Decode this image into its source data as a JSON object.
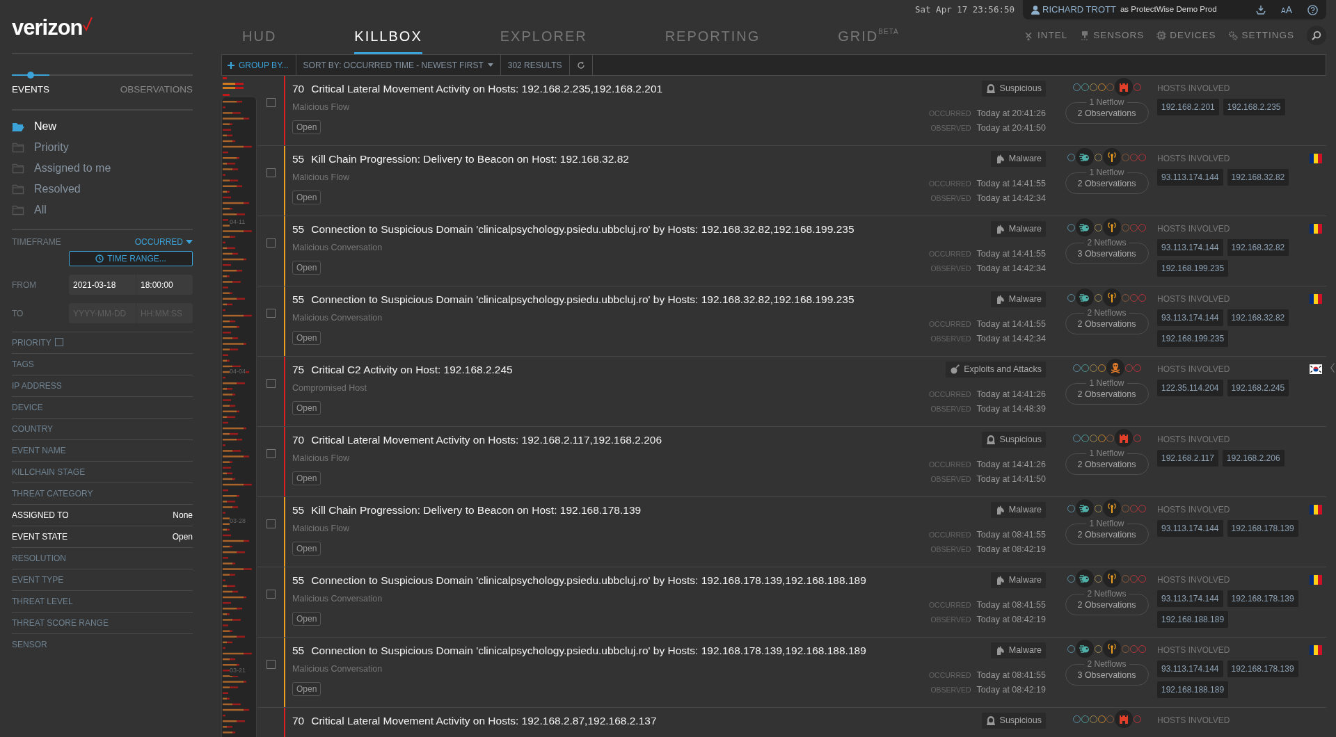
{
  "sidebar": {
    "logo": "verizon",
    "view_tabs": [
      {
        "label": "EVENTS",
        "selected": true
      },
      {
        "label": "OBSERVATIONS",
        "selected": false
      }
    ],
    "folders": [
      {
        "label": "New",
        "selected": true
      },
      {
        "label": "Priority",
        "selected": false
      },
      {
        "label": "Assigned to me",
        "selected": false
      },
      {
        "label": "Resolved",
        "selected": false
      },
      {
        "label": "All",
        "selected": false
      }
    ],
    "timeframe": {
      "label": "TIMEFRAME",
      "mode": "OCCURRED",
      "range_button": "TIME RANGE...",
      "from": {
        "label": "FROM",
        "date": "2021-03-18",
        "time": "18:00:00"
      },
      "to": {
        "label": "TO",
        "date_placeholder": "YYYY-MM-DD",
        "time_placeholder": "HH:MM:SS"
      }
    },
    "filters": [
      {
        "label": "PRIORITY",
        "kind": "checkbox",
        "checked": false
      },
      {
        "label": "TAGS",
        "kind": "plain"
      },
      {
        "label": "IP ADDRESS",
        "kind": "plain"
      },
      {
        "label": "DEVICE",
        "kind": "plain"
      },
      {
        "label": "COUNTRY",
        "kind": "plain"
      },
      {
        "label": "EVENT NAME",
        "kind": "plain"
      },
      {
        "label": "KILLCHAIN STAGE",
        "kind": "plain"
      },
      {
        "label": "THREAT CATEGORY",
        "kind": "plain"
      },
      {
        "label": "ASSIGNED TO",
        "kind": "value",
        "value": "None"
      },
      {
        "label": "EVENT STATE",
        "kind": "value",
        "value": "Open"
      },
      {
        "label": "RESOLUTION",
        "kind": "plain"
      },
      {
        "label": "EVENT TYPE",
        "kind": "plain"
      },
      {
        "label": "THREAT LEVEL",
        "kind": "plain"
      },
      {
        "label": "THREAT SCORE RANGE",
        "kind": "plain"
      },
      {
        "label": "SENSOR",
        "kind": "plain"
      }
    ]
  },
  "header": {
    "clock": "Sat Apr 17 23:56:50",
    "user": {
      "name": "RICHARD TROTT",
      "context": "as ProtectWise Demo Prod"
    },
    "font_size_letters": [
      "A",
      "A"
    ],
    "tabs": [
      {
        "label": "HUD",
        "selected": false
      },
      {
        "label": "KILLBOX",
        "selected": true
      },
      {
        "label": "EXPLORER",
        "selected": false
      },
      {
        "label": "REPORTING",
        "selected": false
      },
      {
        "label": "GRID$^{BETA}$",
        "selected": false
      }
    ],
    "tools": [
      {
        "kind": "intel",
        "label": "INTEL"
      },
      {
        "kind": "sensors",
        "label": "SENSORS"
      },
      {
        "kind": "devices",
        "label": "DEVICES"
      },
      {
        "kind": "settings",
        "label": "SETTINGS"
      }
    ]
  },
  "toolbar": {
    "group_by": "GROUP BY...",
    "sort": "SORT BY: OCCURRED TIME - NEWEST FIRST",
    "results": "302 RESULTS"
  },
  "timeline": {
    "labels": [
      "04-11",
      "04-04",
      "03-28",
      "03-21"
    ]
  },
  "events": [
    {
      "score": "70",
      "color": "#e02020",
      "checked": false,
      "title": "Critical Lateral Movement Activity on Hosts: 192.168.2.235,192.168.2.201",
      "category": "Malicious Flow",
      "status": "Open",
      "tag": {
        "kind": "suspicious",
        "label": "Suspicious"
      },
      "killchain": [
        {
          "active": false
        },
        {
          "active": false
        },
        {
          "active": false
        },
        {
          "active": false
        },
        {
          "active": false
        },
        {
          "active": true
        },
        {
          "active": false
        }
      ],
      "occurred": {
        "label": "OCCURRED",
        "value": "Today at 20:41:26"
      },
      "observed": {
        "label": "OBSERVED",
        "value": "Today at 20:41:50"
      },
      "netflows": "1 Netflow",
      "observations": "2 Observations",
      "hosts_label": "HOSTS INVOLVED",
      "hosts": [
        "192.168.2.201",
        "192.168.2.235"
      ]
    },
    {
      "score": "55",
      "color": "#f0a020",
      "checked": false,
      "title": "Kill Chain Progression: Delivery to Beacon on Host: 192.168.32.82",
      "category": "Malicious Flow",
      "status": "Open",
      "tag": {
        "kind": "malware",
        "label": "Malware"
      },
      "killchain": [
        {
          "active": false
        },
        {
          "active": true
        },
        {
          "active": false
        },
        {
          "active": true
        },
        {
          "active": false
        },
        {
          "active": false
        },
        {
          "active": false
        }
      ],
      "occurred": {
        "label": "OCCURRED",
        "value": "Today at 14:41:55"
      },
      "observed": {
        "label": "OBSERVED",
        "value": "Today at 14:42:34"
      },
      "netflows": "1 Netflow",
      "observations": "2 Observations",
      "hosts_label": "HOSTS INVOLVED",
      "hosts": [
        "93.113.174.144",
        "192.168.32.82"
      ],
      "flag": {
        "kind": "ro"
      }
    },
    {
      "score": "55",
      "color": "#f0a020",
      "checked": false,
      "title": "Connection to Suspicious Domain 'clinicalpsychology.psiedu.ubbcluj.ro' by Hosts: 192.168.32.82,192.168.199.235",
      "category": "Malicious Conversation",
      "status": "Open",
      "tag": {
        "kind": "malware",
        "label": "Malware"
      },
      "killchain": [
        {
          "active": false
        },
        {
          "active": true
        },
        {
          "active": false
        },
        {
          "active": true
        },
        {
          "active": false
        },
        {
          "active": false
        },
        {
          "active": false
        }
      ],
      "occurred": {
        "label": "OCCURRED",
        "value": "Today at 14:41:55"
      },
      "observed": {
        "label": "OBSERVED",
        "value": "Today at 14:42:34"
      },
      "netflows": "2 Netflows",
      "observations": "3 Observations",
      "hosts_label": "HOSTS INVOLVED",
      "hosts": [
        "93.113.174.144",
        "192.168.32.82",
        "192.168.199.235"
      ],
      "flag": {
        "kind": "ro"
      }
    },
    {
      "score": "55",
      "color": "#f0a020",
      "checked": false,
      "title": "Connection to Suspicious Domain 'clinicalpsychology.psiedu.ubbcluj.ro' by Hosts: 192.168.32.82,192.168.199.235",
      "category": "Malicious Conversation",
      "status": "Open",
      "tag": {
        "kind": "malware",
        "label": "Malware"
      },
      "killchain": [
        {
          "active": false
        },
        {
          "active": true
        },
        {
          "active": false
        },
        {
          "active": true
        },
        {
          "active": false
        },
        {
          "active": false
        },
        {
          "active": false
        }
      ],
      "occurred": {
        "label": "OCCURRED",
        "value": "Today at 14:41:55"
      },
      "observed": {
        "label": "OBSERVED",
        "value": "Today at 14:42:34"
      },
      "netflows": "2 Netflows",
      "observations": "2 Observations",
      "hosts_label": "HOSTS INVOLVED",
      "hosts": [
        "93.113.174.144",
        "192.168.32.82",
        "192.168.199.235"
      ],
      "flag": {
        "kind": "ro"
      }
    },
    {
      "score": "75",
      "color": "#e02020",
      "checked": false,
      "title": "Critical C2 Activity on Host: 192.168.2.245",
      "category": "Compromised Host",
      "status": "Open",
      "tag": {
        "kind": "exploits",
        "label": "Exploits and Attacks"
      },
      "killchain": [
        {
          "active": false
        },
        {
          "active": false
        },
        {
          "active": false
        },
        {
          "active": false
        },
        {
          "active": true
        },
        {
          "active": false
        },
        {
          "active": false
        }
      ],
      "occurred": {
        "label": "OCCURRED",
        "value": "Today at 14:41:26"
      },
      "observed": {
        "label": "OBSERVED",
        "value": "Today at 14:48:39"
      },
      "netflows": "1 Netflow",
      "observations": "2 Observations",
      "hosts_label": "HOSTS INVOLVED",
      "hosts": [
        "122.35.114.204",
        "192.168.2.245"
      ],
      "flag": {
        "kind": "kr"
      }
    },
    {
      "score": "70",
      "color": "#e02020",
      "checked": false,
      "title": "Critical Lateral Movement Activity on Hosts: 192.168.2.117,192.168.2.206",
      "category": "Malicious Flow",
      "status": "Open",
      "tag": {
        "kind": "suspicious",
        "label": "Suspicious"
      },
      "killchain": [
        {
          "active": false
        },
        {
          "active": false
        },
        {
          "active": false
        },
        {
          "active": false
        },
        {
          "active": false
        },
        {
          "active": true
        },
        {
          "active": false
        }
      ],
      "occurred": {
        "label": "OCCURRED",
        "value": "Today at 14:41:26"
      },
      "observed": {
        "label": "OBSERVED",
        "value": "Today at 14:41:50"
      },
      "netflows": "1 Netflow",
      "observations": "2 Observations",
      "hosts_label": "HOSTS INVOLVED",
      "hosts": [
        "192.168.2.117",
        "192.168.2.206"
      ]
    },
    {
      "score": "55",
      "color": "#f0a020",
      "checked": false,
      "title": "Kill Chain Progression: Delivery to Beacon on Host: 192.168.178.139",
      "category": "Malicious Flow",
      "status": "Open",
      "tag": {
        "kind": "malware",
        "label": "Malware"
      },
      "killchain": [
        {
          "active": false
        },
        {
          "active": true
        },
        {
          "active": false
        },
        {
          "active": true
        },
        {
          "active": false
        },
        {
          "active": false
        },
        {
          "active": false
        }
      ],
      "occurred": {
        "label": "OCCURRED",
        "value": "Today at 08:41:55"
      },
      "observed": {
        "label": "OBSERVED",
        "value": "Today at 08:42:19"
      },
      "netflows": "1 Netflow",
      "observations": "2 Observations",
      "hosts_label": "HOSTS INVOLVED",
      "hosts": [
        "93.113.174.144",
        "192.168.178.139"
      ],
      "flag": {
        "kind": "ro"
      }
    },
    {
      "score": "55",
      "color": "#f0a020",
      "checked": false,
      "title": "Connection to Suspicious Domain 'clinicalpsychology.psiedu.ubbcluj.ro' by Hosts: 192.168.178.139,192.168.188.189",
      "category": "Malicious Conversation",
      "status": "Open",
      "tag": {
        "kind": "malware",
        "label": "Malware"
      },
      "killchain": [
        {
          "active": false
        },
        {
          "active": true
        },
        {
          "active": false
        },
        {
          "active": true
        },
        {
          "active": false
        },
        {
          "active": false
        },
        {
          "active": false
        }
      ],
      "occurred": {
        "label": "OCCURRED",
        "value": "Today at 08:41:55"
      },
      "observed": {
        "label": "OBSERVED",
        "value": "Today at 08:42:19"
      },
      "netflows": "2 Netflows",
      "observations": "2 Observations",
      "hosts_label": "HOSTS INVOLVED",
      "hosts": [
        "93.113.174.144",
        "192.168.178.139",
        "192.168.188.189"
      ],
      "flag": {
        "kind": "ro"
      }
    },
    {
      "score": "55",
      "color": "#f0a020",
      "checked": false,
      "title": "Connection to Suspicious Domain 'clinicalpsychology.psiedu.ubbcluj.ro' by Hosts: 192.168.178.139,192.168.188.189",
      "category": "Malicious Conversation",
      "status": "Open",
      "tag": {
        "kind": "malware",
        "label": "Malware"
      },
      "killchain": [
        {
          "active": false
        },
        {
          "active": true
        },
        {
          "active": false
        },
        {
          "active": true
        },
        {
          "active": false
        },
        {
          "active": false
        },
        {
          "active": false
        }
      ],
      "occurred": {
        "label": "OCCURRED",
        "value": "Today at 08:41:55"
      },
      "observed": {
        "label": "OBSERVED",
        "value": "Today at 08:42:19"
      },
      "netflows": "2 Netflows",
      "observations": "3 Observations",
      "hosts_label": "HOSTS INVOLVED",
      "hosts": [
        "93.113.174.144",
        "192.168.178.139",
        "192.168.188.189"
      ],
      "flag": {
        "kind": "ro"
      }
    },
    {
      "score": "70",
      "color": "#e02020",
      "title": "Critical Lateral Movement Activity on Hosts: 192.168.2.87,192.168.2.137",
      "tag": {
        "kind": "suspicious",
        "label": "Suspicious"
      },
      "killchain": [
        {
          "active": false
        },
        {
          "active": false
        },
        {
          "active": false
        },
        {
          "active": false
        },
        {
          "active": false
        },
        {
          "active": true
        },
        {
          "active": false
        }
      ],
      "hosts_label": "HOSTS INVOLVED"
    }
  ]
}
